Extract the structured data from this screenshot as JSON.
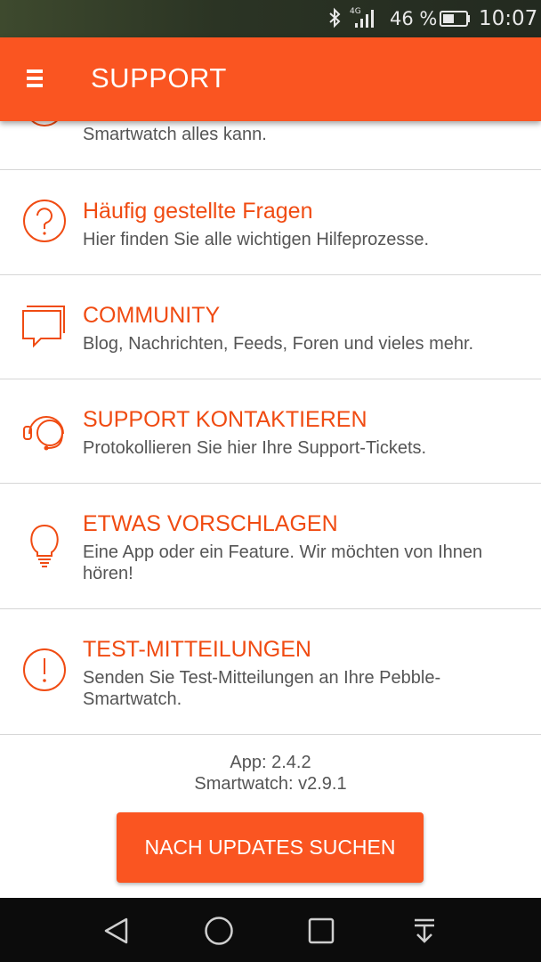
{
  "status_bar": {
    "network": "4G",
    "battery_percent": "46 %",
    "time": "10:07",
    "icons": [
      "bluetooth-icon",
      "signal-icon",
      "battery-icon"
    ]
  },
  "app_bar": {
    "title": "SUPPORT",
    "menu_icon": "menu-icon"
  },
  "partial_item": {
    "description": "Smartwatch alles kann."
  },
  "items": [
    {
      "icon": "question-icon",
      "title": "Häufig gestellte Fragen",
      "description": "Hier finden Sie alle wichtigen Hilfeprozesse."
    },
    {
      "icon": "chat-bubbles-icon",
      "title": "COMMUNITY",
      "description": "Blog, Nachrichten, Feeds, Foren und vieles mehr."
    },
    {
      "icon": "headset-icon",
      "title": "SUPPORT KONTAKTIEREN",
      "description": "Protokollieren Sie hier Ihre Support-Tickets."
    },
    {
      "icon": "lightbulb-icon",
      "title": "ETWAS VORSCHLAGEN",
      "description": "Eine App oder ein Feature. Wir möchten von Ihnen hören!"
    },
    {
      "icon": "exclamation-icon",
      "title": "TEST-MITTEILUNGEN",
      "description": "Senden Sie Test-Mitteilungen an Ihre Pebble-Smartwatch."
    }
  ],
  "version": {
    "app": "App: 2.4.2",
    "smartwatch": "Smartwatch: v2.9.1"
  },
  "update_button_label": "NACH UPDATES SUCHEN",
  "colors": {
    "accent": "#fa5521",
    "title_text": "#f04b12",
    "nav_bar": "#0c0c0c"
  },
  "nav_bar": {
    "icons": [
      "back-icon",
      "home-icon",
      "recent-apps-icon",
      "notification-pull-icon"
    ]
  }
}
